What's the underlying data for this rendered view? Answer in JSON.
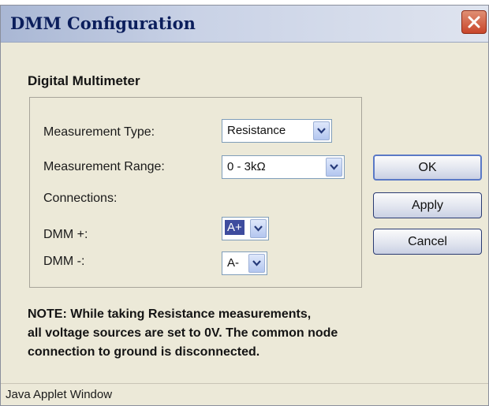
{
  "window": {
    "title": "DMM Configuration"
  },
  "section": {
    "heading": "Digital Multimeter"
  },
  "fields": {
    "measurement_type": {
      "label": "Measurement Type:",
      "value": "Resistance"
    },
    "measurement_range": {
      "label": "Measurement Range:",
      "value": "0 - 3kΩ"
    },
    "connections": {
      "label": "Connections:"
    },
    "dmm_plus": {
      "label": "DMM +:",
      "value": "A+"
    },
    "dmm_minus": {
      "label": "DMM -:",
      "value": "A-"
    }
  },
  "buttons": {
    "ok": "OK",
    "apply": "Apply",
    "cancel": "Cancel"
  },
  "note": {
    "line1": "NOTE: While taking Resistance measurements,",
    "line2": "all voltage sources are set to 0V. The common node",
    "line3": "connection to ground is disconnected."
  },
  "status": {
    "applet_text": "Java Applet Window"
  },
  "icons": {
    "close": "close-icon",
    "dropdown": "chevron-down-icon"
  },
  "colors": {
    "title_bar": "#c9d2e6",
    "close_button": "#c8452b",
    "dialog_bg": "#ece9d8",
    "selection": "#3e4c9e"
  }
}
